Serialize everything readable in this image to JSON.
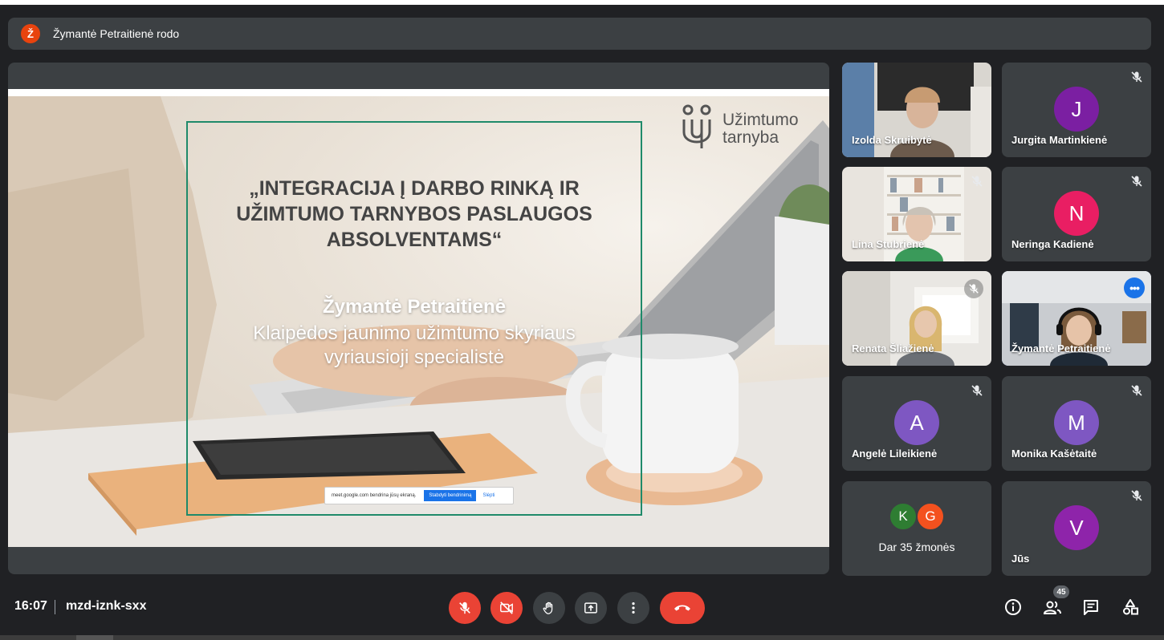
{
  "banner": {
    "avatar_letter": "Ž",
    "text": "Žymantė Petraitienė rodo"
  },
  "slide": {
    "title_line1": "„INTEGRACIJA Į DARBO RINKĄ IR",
    "title_line2": "UŽIMTUMO TARNYBOS PASLAUGOS",
    "title_line3": "ABSOLVENTAMS“",
    "presenter_name": "Žymantė Petraitienė",
    "role_line1": "Klaipėdos jaunimo užimtumo skyriaus",
    "role_line2": "vyriausioji specialistė",
    "logo_line1": "Užimtumo",
    "logo_line2": "tarnyba",
    "notice_text": "meet.google.com bendrina jūsų ekraną.",
    "notice_share_label": "Stabdyti bendrinimą",
    "notice_hide_label": "Slėpti"
  },
  "participants": [
    {
      "name": "Izolda Skruibytė",
      "type": "video"
    },
    {
      "name": "Jurgita Martinkienė",
      "type": "avatar",
      "initial": "J",
      "color": "#7b1fa2",
      "muted": true
    },
    {
      "name": "Lina Stubrienė",
      "type": "video",
      "muted": true
    },
    {
      "name": "Neringa Kadienė",
      "type": "avatar",
      "initial": "N",
      "color": "#e91e63",
      "muted": true
    },
    {
      "name": "Renata Šliažienė",
      "type": "video",
      "muted": true
    },
    {
      "name": "Žymantė Petraitienė",
      "type": "video",
      "active": true
    },
    {
      "name": "Angelė Lileikienė",
      "type": "avatar",
      "initial": "A",
      "color": "#7e57c2",
      "muted": true
    },
    {
      "name": "Monika Kašėtaitė",
      "type": "avatar",
      "initial": "M",
      "color": "#7e57c2",
      "muted": true
    },
    {
      "name": "Jūs",
      "type": "avatar",
      "initial": "V",
      "color": "#8e24aa",
      "muted": true
    }
  ],
  "more_people": {
    "initials": [
      "K",
      "G"
    ],
    "colors": [
      "#2e7d32",
      "#f4511e"
    ],
    "label": "Dar 35 žmonės"
  },
  "bottombar": {
    "time": "16:07",
    "meeting_code": "mzd-iznk-sxx",
    "participant_count": "45"
  },
  "colors": {
    "background": "#202124",
    "tile": "#3c4043",
    "danger": "#ea4335",
    "accent": "#1a73e8"
  }
}
